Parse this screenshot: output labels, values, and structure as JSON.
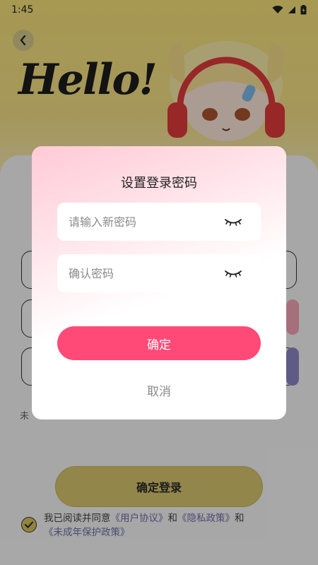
{
  "status_bar": {
    "time": "1:45"
  },
  "header": {
    "hello_text": "Hello!"
  },
  "background": {
    "note_text": "未",
    "login_button_label": "确定登录",
    "agreement": {
      "prefix": "我已阅读并同意",
      "user_agreement": "《用户协议》",
      "and1": "和",
      "privacy_policy": "《隐私政策》",
      "and2": "和",
      "minor_policy": "《未成年保护政策》"
    }
  },
  "dialog": {
    "title": "设置登录密码",
    "new_password_placeholder": "请输入新密码",
    "confirm_password_placeholder": "确认密码",
    "confirm_label": "确定",
    "cancel_label": "取消"
  },
  "colors": {
    "accent_pink": "#ff4a78",
    "brand_yellow": "#f6e27a",
    "link_purple": "#6f6da8"
  }
}
